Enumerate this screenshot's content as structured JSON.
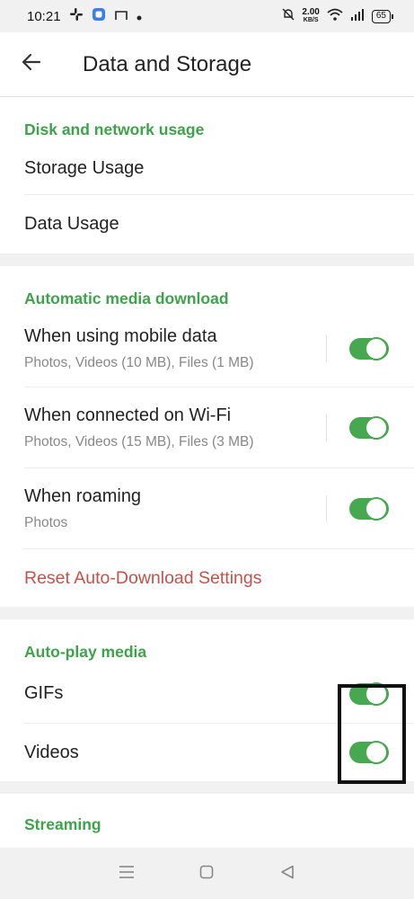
{
  "status_bar": {
    "time": "10:21",
    "net_speed_value": "2.00",
    "net_speed_unit": "KB/S",
    "battery": "65"
  },
  "app_bar": {
    "title": "Data and Storage"
  },
  "sections": {
    "disk": {
      "header": "Disk and network usage",
      "items": [
        {
          "title": "Storage Usage"
        },
        {
          "title": "Data Usage"
        }
      ]
    },
    "auto_download": {
      "header": "Automatic media download",
      "items": [
        {
          "title": "When using mobile data",
          "subtitle": "Photos, Videos (10 MB), Files (1 MB)",
          "enabled": true
        },
        {
          "title": "When connected on Wi-Fi",
          "subtitle": "Photos, Videos (15 MB), Files (3 MB)",
          "enabled": true
        },
        {
          "title": "When roaming",
          "subtitle": "Photos",
          "enabled": true
        }
      ],
      "reset_label": "Reset Auto-Download Settings"
    },
    "autoplay": {
      "header": "Auto-play media",
      "items": [
        {
          "title": "GIFs",
          "enabled": true
        },
        {
          "title": "Videos",
          "enabled": true
        }
      ]
    },
    "streaming": {
      "header": "Streaming"
    }
  },
  "colors": {
    "accent_green": "#3ea34a",
    "reset_red": "#c4514a",
    "toggle_on": "#46a84f"
  }
}
